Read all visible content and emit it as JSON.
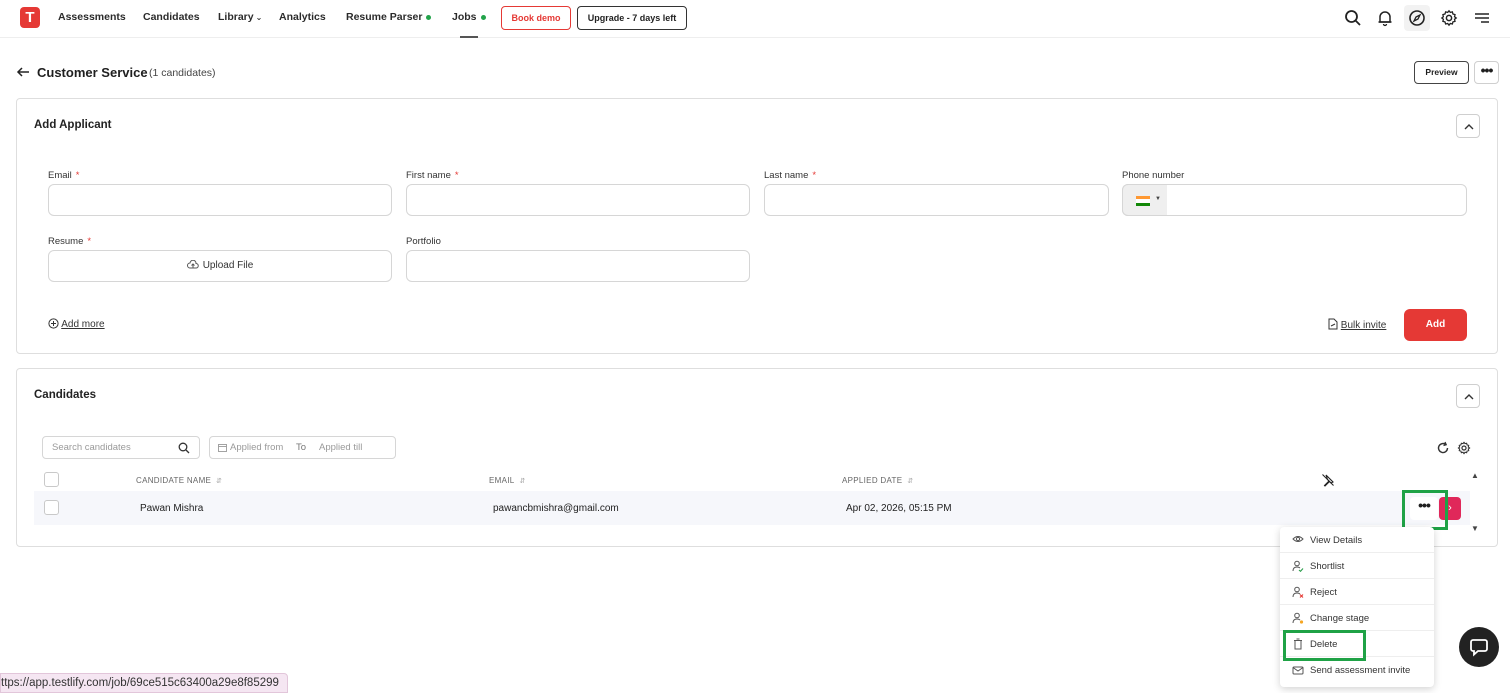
{
  "nav": {
    "logo": "T",
    "items": [
      "Assessments",
      "Candidates",
      "Library",
      "Analytics",
      "Resume Parser",
      "Jobs"
    ],
    "book_demo": "Book demo",
    "upgrade": "Upgrade - 7 days left"
  },
  "header": {
    "title": "Customer Service",
    "subtitle": "(1 candidates)",
    "preview": "Preview",
    "more": "•••"
  },
  "add_applicant": {
    "title": "Add Applicant",
    "email_label": "Email",
    "first_name_label": "First name",
    "last_name_label": "Last name",
    "phone_label": "Phone number",
    "resume_label": "Resume",
    "upload_label": "Upload File",
    "portfolio_label": "Portfolio",
    "required_mark": "*",
    "add_more": "Add more",
    "bulk_invite": "Bulk invite",
    "add_button": "Add"
  },
  "candidates": {
    "title": "Candidates",
    "search_placeholder": "Search candidates",
    "applied_from": "Applied from",
    "to": "To",
    "applied_till": "Applied till",
    "columns": [
      "CANDIDATE NAME",
      "EMAIL",
      "APPLIED DATE"
    ],
    "rows": [
      {
        "name": "Pawan Mishra",
        "email": "pawancbmishra@gmail.com",
        "applied": "Apr 02, 2026, 05:15 PM"
      }
    ],
    "row_more": "•••",
    "row_go": "›"
  },
  "menu": {
    "items": [
      "View Details",
      "Shortlist",
      "Reject",
      "Change stage",
      "Delete",
      "Send assessment invite"
    ]
  },
  "status_url": "ttps://app.testlify.com/job/69ce515c63400a29e8f85299",
  "colors": {
    "brand": "#e53935",
    "highlight": "#1fa246",
    "row_action": "#e0285a",
    "online_dot": "#22a34a"
  }
}
